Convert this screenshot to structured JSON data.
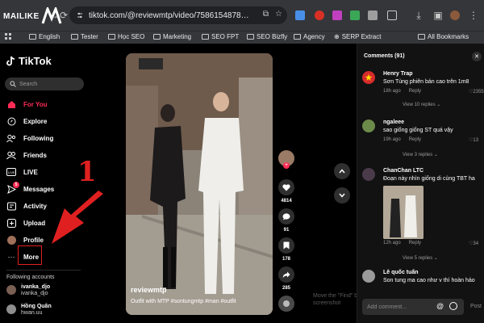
{
  "browser": {
    "brand": "MAILIKE",
    "url": "tiktok.com/@reviewmtp/video/7586154878175...",
    "bookmarks": [
      "English",
      "Tester",
      "Học SEO",
      "Marketing",
      "SEO FPT",
      "SEO Bizfly",
      "Agency",
      "SERP Extract",
      "All Bookmarks"
    ]
  },
  "sidebar": {
    "logo": "TikTok",
    "search_placeholder": "Search",
    "items": [
      {
        "label": "For You",
        "icon": "home-icon"
      },
      {
        "label": "Explore",
        "icon": "compass-icon"
      },
      {
        "label": "Following",
        "icon": "following-icon"
      },
      {
        "label": "Friends",
        "icon": "friends-icon"
      },
      {
        "label": "LIVE",
        "icon": "live-icon"
      },
      {
        "label": "Messages",
        "icon": "messages-icon",
        "badge": "5"
      },
      {
        "label": "Activity",
        "icon": "activity-icon"
      },
      {
        "label": "Upload",
        "icon": "upload-icon"
      },
      {
        "label": "Profile",
        "icon": "profile-icon"
      },
      {
        "label": "More",
        "icon": "more-icon"
      }
    ],
    "following_title": "Following accounts",
    "accounts": [
      {
        "name": "ivanka_djo",
        "sub": "ivanka_djo"
      },
      {
        "name": "Hồng Quân",
        "sub": "hwan.uu"
      }
    ]
  },
  "annotation": {
    "number": "1",
    "color": "#e02020"
  },
  "video": {
    "username": "reviewmtp",
    "description": "Outfit with MTP #sontungmtp #man #outfit",
    "actions": [
      {
        "name": "like",
        "count": "4814"
      },
      {
        "name": "comment",
        "count": "91"
      },
      {
        "name": "bookmark",
        "count": "178"
      },
      {
        "name": "share",
        "count": "285"
      }
    ]
  },
  "watermark": [
    "Move the \"Find\" bar as you are in any",
    "screenshot"
  ],
  "comments": {
    "title": "Comments (91)",
    "items": [
      {
        "user": "Henry Trap",
        "text": "Sơn Tùng phiên bản cao trên 1m8",
        "time": "18h ago",
        "reply": "Reply",
        "likes": "2355",
        "replies": "View 10 replies ⌄"
      },
      {
        "user": "ngaleee",
        "text": "sao giống giống ST quá vậy",
        "time": "19h ago",
        "reply": "Reply",
        "likes": "13",
        "replies": "View 3 replies ⌄"
      },
      {
        "user": "ChanChan LTC",
        "text": "Đoạn này nhìn giống di cùng TBT ha",
        "time": "12h ago",
        "reply": "Reply",
        "likes": "34",
        "replies": "View 5 replies ⌄"
      },
      {
        "user": "Lê quốc tuấn",
        "text": "Son tung ma cao như v thì hoàn hảo",
        "time": "",
        "reply": "",
        "likes": "",
        "replies": ""
      }
    ],
    "input_placeholder": "Add comment...",
    "post": "Post"
  },
  "colors": {
    "accent": "#fe2c55",
    "annotation": "#e02020"
  }
}
